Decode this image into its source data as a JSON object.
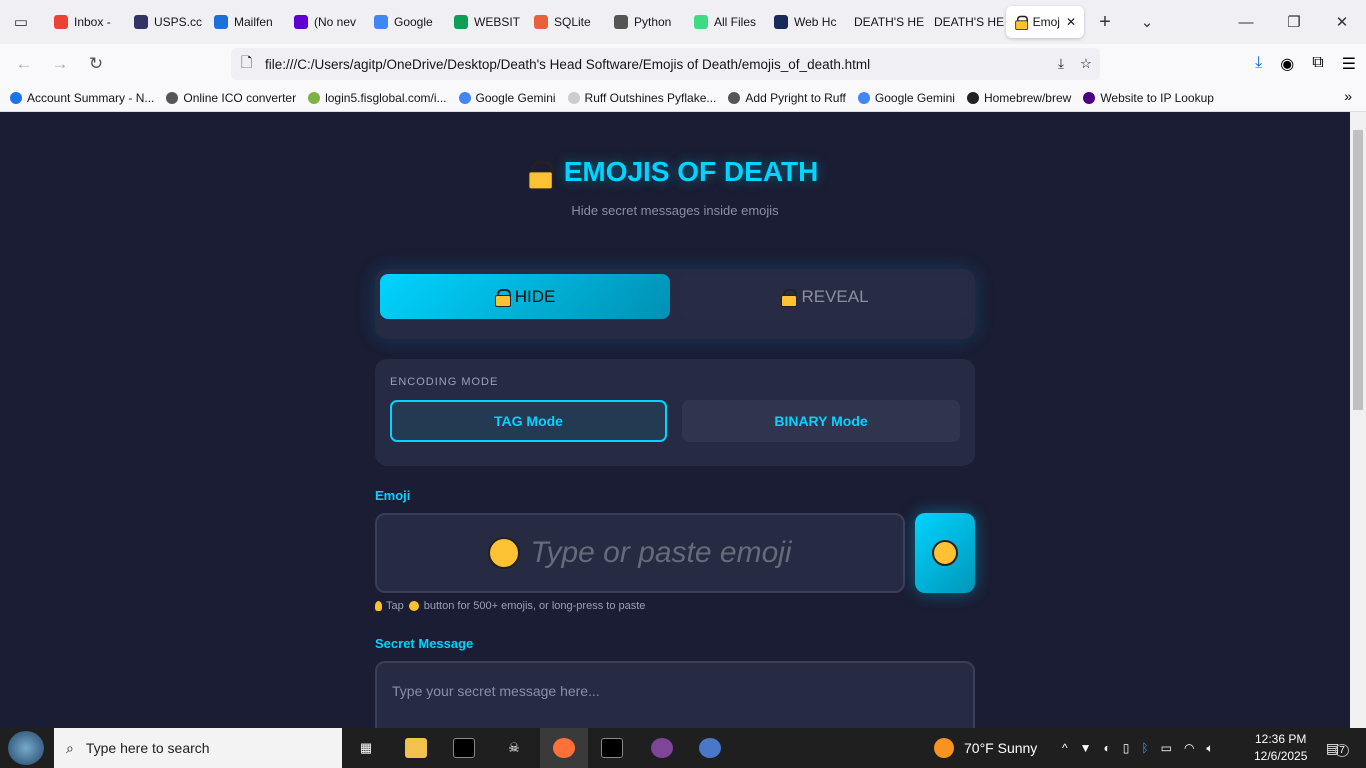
{
  "browser": {
    "tabs": [
      {
        "label": "Inbox -",
        "color": "#ea4335"
      },
      {
        "label": "USPS.cc",
        "color": "#333366"
      },
      {
        "label": "Mailfen",
        "color": "#1e6fd9"
      },
      {
        "label": "(No nev",
        "color": "#6001d2"
      },
      {
        "label": "Google",
        "color": "#4285f4"
      },
      {
        "label": "WEBSIT",
        "color": "#0f9d58"
      },
      {
        "label": "SQLite",
        "color": "#e8603c"
      },
      {
        "label": "Python",
        "color": "#555555"
      },
      {
        "label": "All Files",
        "color": "#3ddc84"
      },
      {
        "label": "Web Hc",
        "color": "#1a2a5a"
      },
      {
        "label": "DEATH'S HE",
        "color": ""
      },
      {
        "label": "DEATH'S HE",
        "color": ""
      }
    ],
    "active_tab": "Emoj",
    "url": "file:///C:/Users/agitp/OneDrive/Desktop/Death's Head Software/Emojis of Death/emojis_of_death.html",
    "bookmarks": [
      "Account Summary - N...",
      "Online ICO converter",
      "login5.fisglobal.com/i...",
      "Google Gemini",
      "Ruff Outshines Pyflake...",
      "Add Pyright to Ruff",
      "Google Gemini",
      "Homebrew/brew",
      "Website to IP Lookup"
    ]
  },
  "app": {
    "title": "EMOJIS OF DEATH",
    "subtitle": "Hide secret messages inside emojis",
    "modes": {
      "hide": "HIDE",
      "reveal": "REVEAL"
    },
    "encoding_label": "ENCODING MODE",
    "encoding": {
      "tag": "TAG Mode",
      "binary": "BINARY Mode",
      "selected": "tag"
    },
    "emoji_label": "Emoji",
    "emoji_placeholder": "Type or paste emoji",
    "hint_pre": "Tap",
    "hint_post": "button for 500+ emojis, or long-press to paste",
    "secret_label": "Secret Message",
    "secret_placeholder": "Type your secret message here...",
    "accent": "#00d4ff"
  },
  "taskbar": {
    "search_placeholder": "Type here to search",
    "weather": "70°F  Sunny",
    "time": "12:36 PM",
    "date": "12/6/2025",
    "notifications": "7"
  }
}
